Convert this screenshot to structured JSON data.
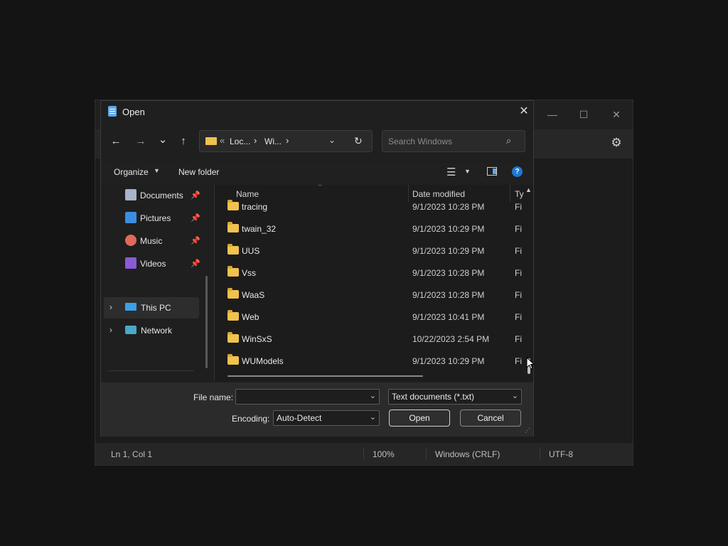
{
  "dialog": {
    "title": "Open",
    "close_icon": "close-icon"
  },
  "nav": {
    "back_icon": "←",
    "forward_icon": "→",
    "recent_icon": "⌄",
    "up_icon": "↑"
  },
  "address": {
    "overflow": "«",
    "segments": [
      "Loc...",
      "Wi..."
    ],
    "separator": "›"
  },
  "search": {
    "placeholder": "Search Windows"
  },
  "commandbar": {
    "organize_label": "Organize",
    "new_folder_label": "New folder"
  },
  "nav_pane": {
    "quick_access": [
      {
        "label": "Documents",
        "icon": "documents-icon",
        "color": "#a8b4c8"
      },
      {
        "label": "Pictures",
        "icon": "pictures-icon",
        "color": "#3a8ee0"
      },
      {
        "label": "Music",
        "icon": "music-icon",
        "color": "#e06a5a"
      },
      {
        "label": "Videos",
        "icon": "videos-icon",
        "color": "#8a5ad8"
      }
    ],
    "locations": [
      {
        "label": "This PC",
        "icon": "this-pc-icon",
        "selected": true
      },
      {
        "label": "Network",
        "icon": "network-icon",
        "selected": false
      }
    ]
  },
  "file_list": {
    "columns": {
      "name": "Name",
      "date": "Date modified",
      "type": "Ty"
    },
    "rows": [
      {
        "name": "tracing",
        "date": "9/1/2023 10:28 PM",
        "type": "Fi"
      },
      {
        "name": "twain_32",
        "date": "9/1/2023 10:29 PM",
        "type": "Fi"
      },
      {
        "name": "UUS",
        "date": "9/1/2023 10:29 PM",
        "type": "Fi"
      },
      {
        "name": "Vss",
        "date": "9/1/2023 10:28 PM",
        "type": "Fi"
      },
      {
        "name": "WaaS",
        "date": "9/1/2023 10:28 PM",
        "type": "Fi"
      },
      {
        "name": "Web",
        "date": "9/1/2023 10:41 PM",
        "type": "Fi"
      },
      {
        "name": "WinSxS",
        "date": "10/22/2023 2:54 PM",
        "type": "Fi"
      },
      {
        "name": "WUModels",
        "date": "9/1/2023 10:29 PM",
        "type": "Fi"
      }
    ]
  },
  "bottom": {
    "file_name_label": "File name:",
    "file_name_value": "",
    "file_type_value": "Text documents (*.txt)",
    "encoding_label": "Encoding:",
    "encoding_value": "Auto-Detect",
    "open_label": "Open",
    "cancel_label": "Cancel"
  },
  "notepad_status": {
    "position": "Ln 1, Col 1",
    "zoom": "100%",
    "line_ending": "Windows (CRLF)",
    "encoding": "UTF-8"
  },
  "colors": {
    "accent": "#0078d4",
    "folder": "#f0c24e"
  }
}
